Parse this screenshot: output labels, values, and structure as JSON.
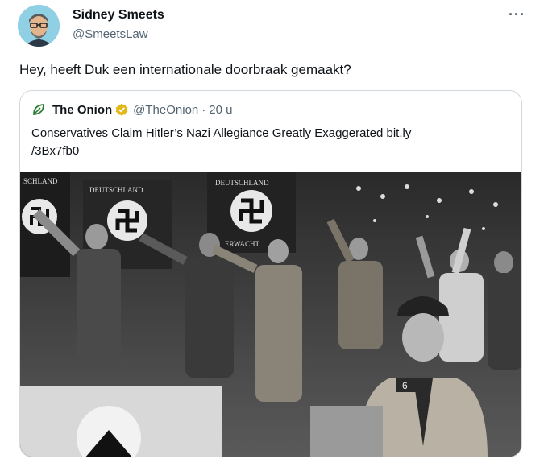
{
  "author": {
    "name": "Sidney Smeets",
    "handle": "@SmeetsLaw",
    "avatar_icon": "avatar-illustration"
  },
  "more_icon": "more-icon",
  "more_label": "···",
  "tweet": {
    "text": "Hey, heeft Duk een internationale doorbraak gemaakt?"
  },
  "quote": {
    "logo_icon": "onion-leaf-icon",
    "logo_color": "#2e7d32",
    "name": "The Onion",
    "verified_icon": "verified-gold-badge-icon",
    "verified_color": "#e2b719",
    "handle": "@TheOnion",
    "separator": "·",
    "time": "20 u",
    "text_line1": "Conservatives Claim Hitler’s Nazi Allegiance Greatly Exaggerated bit.ly",
    "text_line2": "/3Bx7fb0",
    "image": {
      "banner_text_1": "DEUTSCHLAND",
      "banner_text_2": "DEUTSCHLAND",
      "banner_text_3": "SCHLAND",
      "banner_text_4": "ERWACHT",
      "armband_number": "6"
    }
  },
  "colors": {
    "text": "#0f1419",
    "secondary": "#536471",
    "border": "#cfd9de"
  }
}
